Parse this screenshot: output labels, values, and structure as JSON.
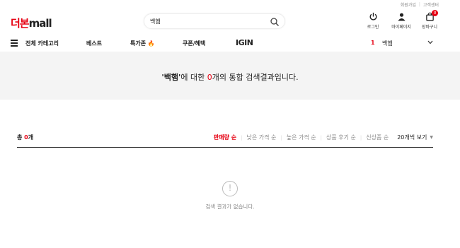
{
  "header": {
    "util_links": [
      "회원가입",
      "고객센터"
    ],
    "logo_korean": "더본",
    "logo_latin": "mall",
    "search": {
      "value": "백햄",
      "placeholder": ""
    },
    "icons": [
      {
        "name": "power-icon",
        "label": "로그인"
      },
      {
        "name": "user-icon",
        "label": "마이페이지"
      },
      {
        "name": "bag-icon",
        "label": "장바구니",
        "badge": "0"
      }
    ]
  },
  "nav": {
    "items": [
      "전체 카테고리",
      "베스트",
      "특가존 🔥",
      "쿠폰/혜택",
      "IGIN"
    ],
    "trending_rank": "1",
    "trending_keyword": "백햄"
  },
  "result": {
    "query_quoted": "'백햄'",
    "prefix": "에 대한 ",
    "count": "0",
    "suffix": "개의 통합 검색결과입니다."
  },
  "toolbar": {
    "total_label": "총 ",
    "total_count": "0",
    "total_unit": "개",
    "sort_options": [
      "판매량 순",
      "낮은 가격 순",
      "높은 가격 순",
      "상품 후기 순",
      "신상품 순"
    ],
    "active_sort": "판매량 순",
    "per_page": "20개씩 보기"
  },
  "empty": {
    "message": "검색 결과가 없습니다."
  },
  "colors": {
    "accent": "#e60012",
    "banner_bg": "#f4f4f4"
  }
}
